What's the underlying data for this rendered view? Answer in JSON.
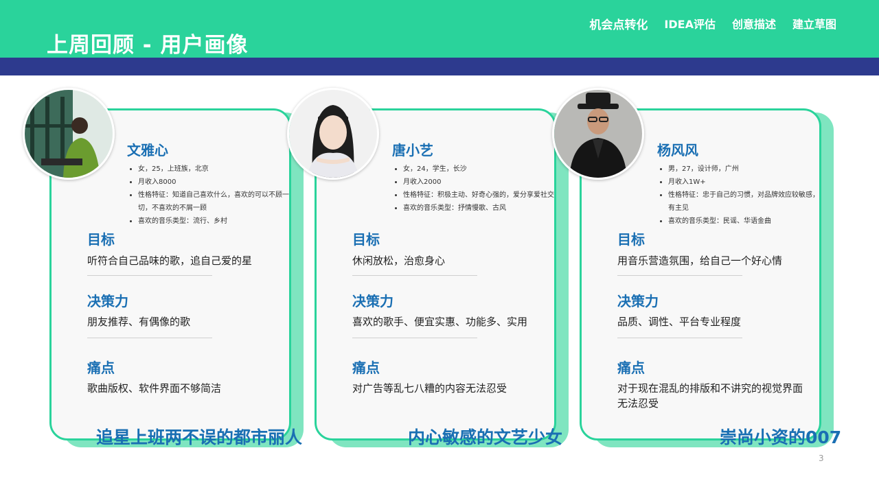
{
  "header": {
    "title": "上周回顾 - 用户画像",
    "nav": [
      "机会点转化",
      "IDEA评估",
      "创意描述",
      "建立草图"
    ]
  },
  "section_labels": {
    "goal": "目标",
    "decision": "决策力",
    "pain": "痛点"
  },
  "personas": [
    {
      "name": "文雅心",
      "bullets": [
        "女，25，上班族，北京",
        "月收入8000",
        "性格特征：知道自己喜欢什么，喜欢的可以不顾一切，不喜欢的不屑一顾",
        "喜欢的音乐类型：流行、乡村"
      ],
      "goal": "听符合自己品味的歌，追自己爱的星",
      "decision": "朋友推荐、有偶像的歌",
      "pain": "歌曲版权、软件界面不够简洁",
      "tagline": "追星上班两不误的都市丽人"
    },
    {
      "name": "唐小艺",
      "bullets": [
        "女，24，学生，长沙",
        "月收入2000",
        "性格特征：积极主动、好奇心强的，爱分享爱社交",
        "喜欢的音乐类型：抒情慢歌、古风"
      ],
      "goal": "休闲放松，治愈身心",
      "decision": "喜欢的歌手、便宜实惠、功能多、实用",
      "pain": "对广告等乱七八糟的内容无法忍受",
      "tagline": "内心敏感的文艺少女"
    },
    {
      "name": "杨风风",
      "bullets": [
        "男，27，设计师，广州",
        "月收入1W+",
        "性格特征：忠于自己的习惯，对品牌效应较敏感，有主见",
        "喜欢的音乐类型：民谣、华语金曲"
      ],
      "goal": "用音乐营造氛围，给自己一个好心情",
      "decision": "品质、调性、平台专业程度",
      "pain": "对于现在混乱的排版和不讲究的视觉界面无法忍受",
      "tagline": "崇尚小资的007"
    }
  ],
  "page_number": "3",
  "colors": {
    "header_green": "#2ad39b",
    "band_navy": "#2d3a8e",
    "accent_blue": "#1a6fb3",
    "card_shadow": "#7fe5c0"
  }
}
